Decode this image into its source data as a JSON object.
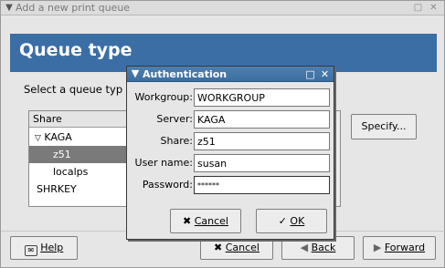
{
  "main_window": {
    "title": "Add a new print queue",
    "header_title": "Queue type",
    "prompt": "Select a queue typ",
    "list": {
      "header": "Share",
      "items": [
        {
          "label": "KAGA",
          "expanded": true
        },
        {
          "label": "z51",
          "selected": true
        },
        {
          "label": "localps"
        },
        {
          "label": "SHRKEY"
        }
      ]
    },
    "specify_label": "Specify...",
    "buttons": {
      "help": "Help",
      "cancel": "Cancel",
      "back": "Back",
      "forward": "Forward"
    }
  },
  "auth_dialog": {
    "title": "Authentication",
    "fields": {
      "workgroup_label": "Workgroup:",
      "workgroup_value": "WORKGROUP",
      "server_label": "Server:",
      "server_value": "KAGA",
      "share_label": "Share:",
      "share_value": "z51",
      "username_label": "User name:",
      "username_value": "susan",
      "password_label": "Password:",
      "password_value": "******"
    },
    "buttons": {
      "cancel": "Cancel",
      "ok": "OK"
    }
  },
  "colors": {
    "header_band": "#3b6ea5",
    "dialog_titlebar": "#4e7fb0",
    "selection": "#7a7a7a"
  },
  "icons": [
    "window-menu-icon",
    "maximize-icon",
    "close-icon",
    "tree-expander-icon",
    "help-icon",
    "cancel-icon",
    "back-arrow-icon",
    "forward-arrow-icon",
    "ok-check-icon"
  ]
}
